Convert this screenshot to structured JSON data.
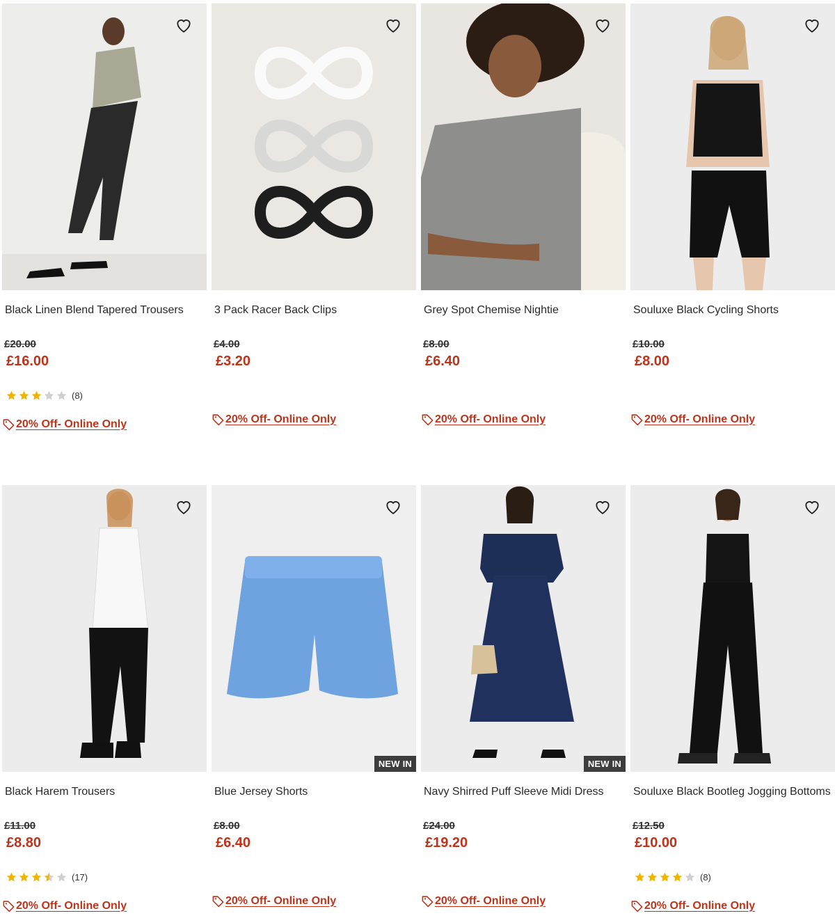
{
  "products": [
    {
      "name": "Black Linen Blend Tapered Trousers",
      "was": "£20.00",
      "now": "£16.00",
      "rating": 3,
      "reviews": "(8)",
      "promo": "20% Off- Online Only",
      "badge": ""
    },
    {
      "name": "3 Pack Racer Back Clips",
      "was": "£4.00",
      "now": "£3.20",
      "rating": null,
      "reviews": "",
      "promo": "20% Off- Online Only",
      "badge": ""
    },
    {
      "name": "Grey Spot Chemise Nightie",
      "was": "£8.00",
      "now": "£6.40",
      "rating": null,
      "reviews": "",
      "promo": "20% Off- Online Only",
      "badge": ""
    },
    {
      "name": "Souluxe Black Cycling Shorts",
      "was": "£10.00",
      "now": "£8.00",
      "rating": null,
      "reviews": "",
      "promo": "20% Off- Online Only",
      "badge": ""
    },
    {
      "name": "Black Harem Trousers",
      "was": "£11.00",
      "now": "£8.80",
      "rating": 3.5,
      "reviews": "(17)",
      "promo": "20% Off- Online Only",
      "badge": ""
    },
    {
      "name": "Blue Jersey Shorts",
      "was": "£8.00",
      "now": "£6.40",
      "rating": null,
      "reviews": "",
      "promo": "20% Off- Online Only",
      "badge": "NEW IN"
    },
    {
      "name": "Navy Shirred Puff Sleeve Midi Dress",
      "was": "£24.00",
      "now": "£19.20",
      "rating": null,
      "reviews": "",
      "promo": "20% Off- Online Only",
      "badge": "NEW IN"
    },
    {
      "name": "Souluxe Black Bootleg Jogging Bottoms",
      "was": "£12.50",
      "now": "£10.00",
      "rating": 4,
      "reviews": "(8)",
      "promo": "20% Off- Online Only",
      "badge": ""
    }
  ],
  "colors": {
    "sale": "#c0331b",
    "star": "#f0b400",
    "star_empty": "#cfcfcf",
    "badge_bg": "#3d3d3d"
  },
  "icons": {
    "wishlist": "heart-outline-icon",
    "promo": "price-tag-icon",
    "rating": "star-icon"
  }
}
